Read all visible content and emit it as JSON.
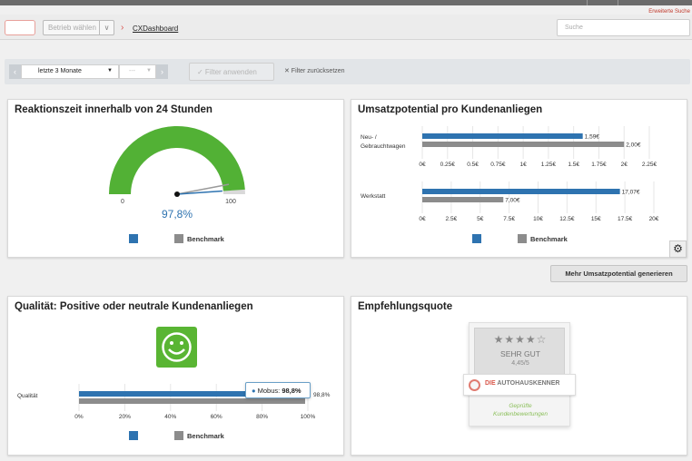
{
  "header": {
    "advanced_search": "Erweiterte Suche",
    "business_select_placeholder": "Betrieb wählen",
    "breadcrumb": "CXDashboard",
    "search_placeholder": "Suche"
  },
  "filters": {
    "period": "letzte 3 Monate",
    "secondary": "---",
    "apply": "✓ Filter anwenden",
    "reset": "✕ Filter zurücksetzen"
  },
  "cards": {
    "reaction": {
      "title": "Reaktionszeit innerhalb von 24 Stunden",
      "value": "97,8%",
      "value_fraction": 0.978,
      "benchmark_fraction": 0.94,
      "min_label": "0",
      "max_label": "100",
      "legend_benchmark": "Benchmark"
    },
    "revenue": {
      "title": "Umsatzpotential pro Kundenanliegen",
      "legend_benchmark": "Benchmark",
      "generate_button": "Mehr Umsatzpotential generieren"
    },
    "quality": {
      "title": "Qualität: Positive oder neutrale Kundenanliegen",
      "legend_benchmark": "Benchmark",
      "tooltip_prefix": "Mobus: ",
      "tooltip_value": "98,8%"
    },
    "recommend": {
      "title": "Empfehlungsquote",
      "rating_label": "SEHR GUT",
      "rating_value": "4,45/5",
      "brand_prefix": "DIE ",
      "brand_name": "AUTOHAUSKENNER",
      "verified_line1": "Geprüfte",
      "verified_line2": "Kundenbewertungen"
    }
  },
  "colors": {
    "primary": "#2e73b0",
    "benchmark": "#8c8c8c",
    "gauge_green": "#52b135",
    "smiley_green": "#59b533"
  },
  "chart_data": [
    {
      "type": "bar",
      "title": "Umsatzpotential pro Kundenanliegen",
      "categories": [
        "Neu- / Gebrauchtwagen"
      ],
      "series": [
        {
          "values": [
            1.59
          ]
        },
        {
          "name": "Benchmark",
          "values": [
            2.0
          ]
        }
      ],
      "data_labels": [
        "1,59€",
        "2,00€"
      ],
      "xlim": [
        0,
        2.25
      ],
      "ticks": [
        "0€",
        "0.25€",
        "0.5€",
        "0.75€",
        "1€",
        "1.25€",
        "1.5€",
        "1.75€",
        "2€",
        "2.25€"
      ]
    },
    {
      "type": "bar",
      "categories": [
        "Werkstatt"
      ],
      "series": [
        {
          "values": [
            17.07
          ]
        },
        {
          "name": "Benchmark",
          "values": [
            7.0
          ]
        }
      ],
      "data_labels": [
        "17,07€",
        "7,00€"
      ],
      "xlim": [
        0,
        20
      ],
      "ticks": [
        "0€",
        "2.5€",
        "5€",
        "7.5€",
        "10€",
        "12.5€",
        "15€",
        "17.5€",
        "20€"
      ]
    },
    {
      "type": "bar",
      "categories": [
        "Qualität"
      ],
      "series": [
        {
          "values": [
            98.8
          ]
        },
        {
          "name": "Benchmark",
          "values": [
            98.8
          ]
        }
      ],
      "data_labels": [
        "98,8%"
      ],
      "xlim": [
        0,
        100
      ],
      "ticks": [
        "0%",
        "20%",
        "40%",
        "60%",
        "80%",
        "100%"
      ]
    }
  ]
}
